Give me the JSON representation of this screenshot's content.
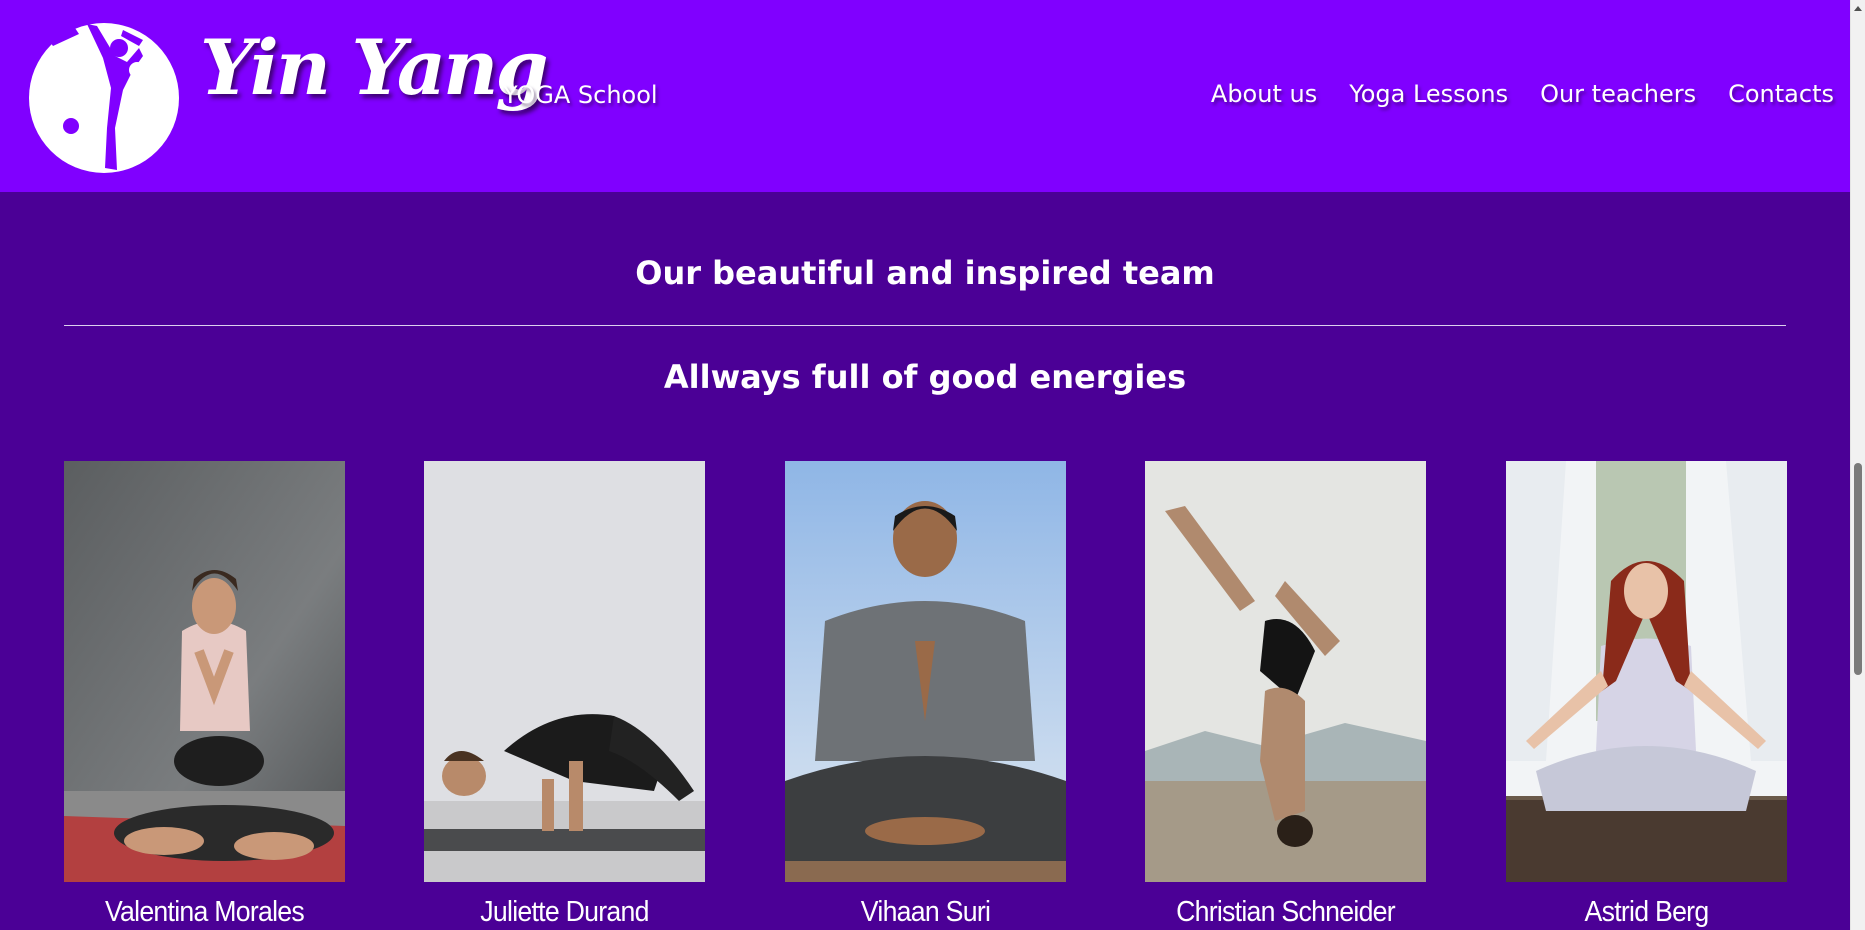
{
  "header": {
    "brand": "Yin Yang",
    "tagline": "YOGA School",
    "nav": [
      {
        "label": "About us"
      },
      {
        "label": "Yoga Lessons"
      },
      {
        "label": "Our teachers"
      },
      {
        "label": "Contacts"
      }
    ]
  },
  "main": {
    "headline": "Our beautiful and inspired team",
    "subheadline": "Allways full of good energies",
    "teachers": [
      {
        "name": "Valentina Morales"
      },
      {
        "name": "Juliette Durand"
      },
      {
        "name": "Vihaan Suri"
      },
      {
        "name": "Christian Schneider"
      },
      {
        "name": "Astrid Berg"
      }
    ]
  },
  "colors": {
    "header_bg": "#8000ff",
    "page_bg": "#4b0096",
    "text": "#ffffff"
  },
  "icons": {
    "logo": "yin-yang-yogi-logo"
  }
}
